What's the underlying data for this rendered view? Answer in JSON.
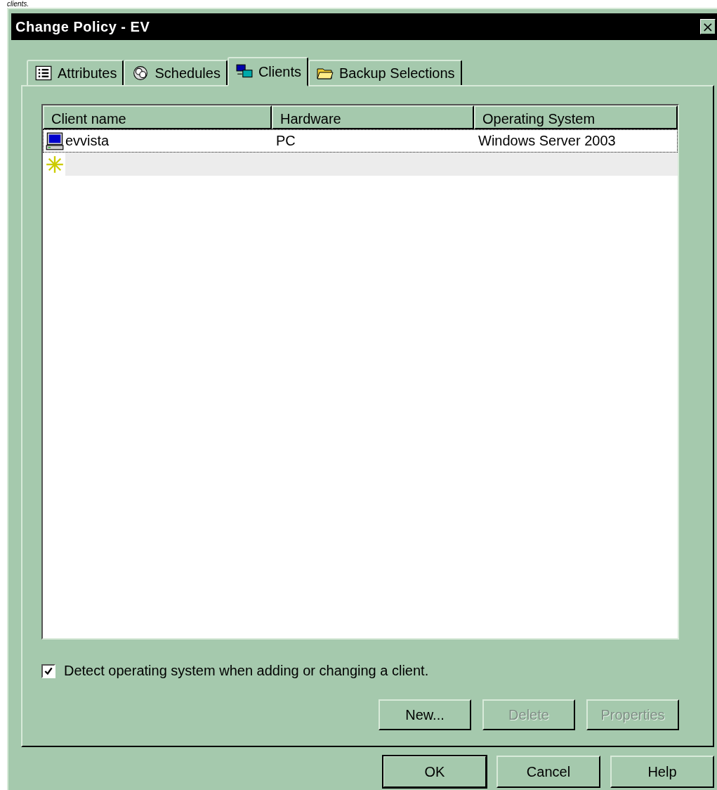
{
  "caption": "clients.",
  "window": {
    "title": "Change Policy - EV",
    "close": "×"
  },
  "tabs": [
    {
      "label": "Attributes",
      "kind": "list",
      "selected": false
    },
    {
      "label": "Schedules",
      "kind": "clock",
      "selected": false
    },
    {
      "label": "Clients",
      "kind": "computers",
      "selected": true
    },
    {
      "label": "Backup Selections",
      "kind": "folder",
      "selected": false
    }
  ],
  "table": {
    "columns": [
      "Client name",
      "Hardware",
      "Operating System"
    ],
    "rows": [
      {
        "kind": "client",
        "selected": true,
        "cells": [
          "evvista",
          "PC",
          "Windows Server 2003"
        ]
      },
      {
        "kind": "new",
        "selected": false,
        "cells": []
      }
    ]
  },
  "detect_checkbox": {
    "label": "Detect operating system when adding or changing a client.",
    "checked": true
  },
  "panel_buttons": [
    {
      "label": "New...",
      "disabled": false
    },
    {
      "label": "Delete",
      "disabled": true
    },
    {
      "label": "Properties",
      "disabled": true
    }
  ],
  "dialog_buttons": [
    {
      "label": "OK",
      "default": true
    },
    {
      "label": "Cancel",
      "default": false
    },
    {
      "label": "Help",
      "default": false
    }
  ]
}
